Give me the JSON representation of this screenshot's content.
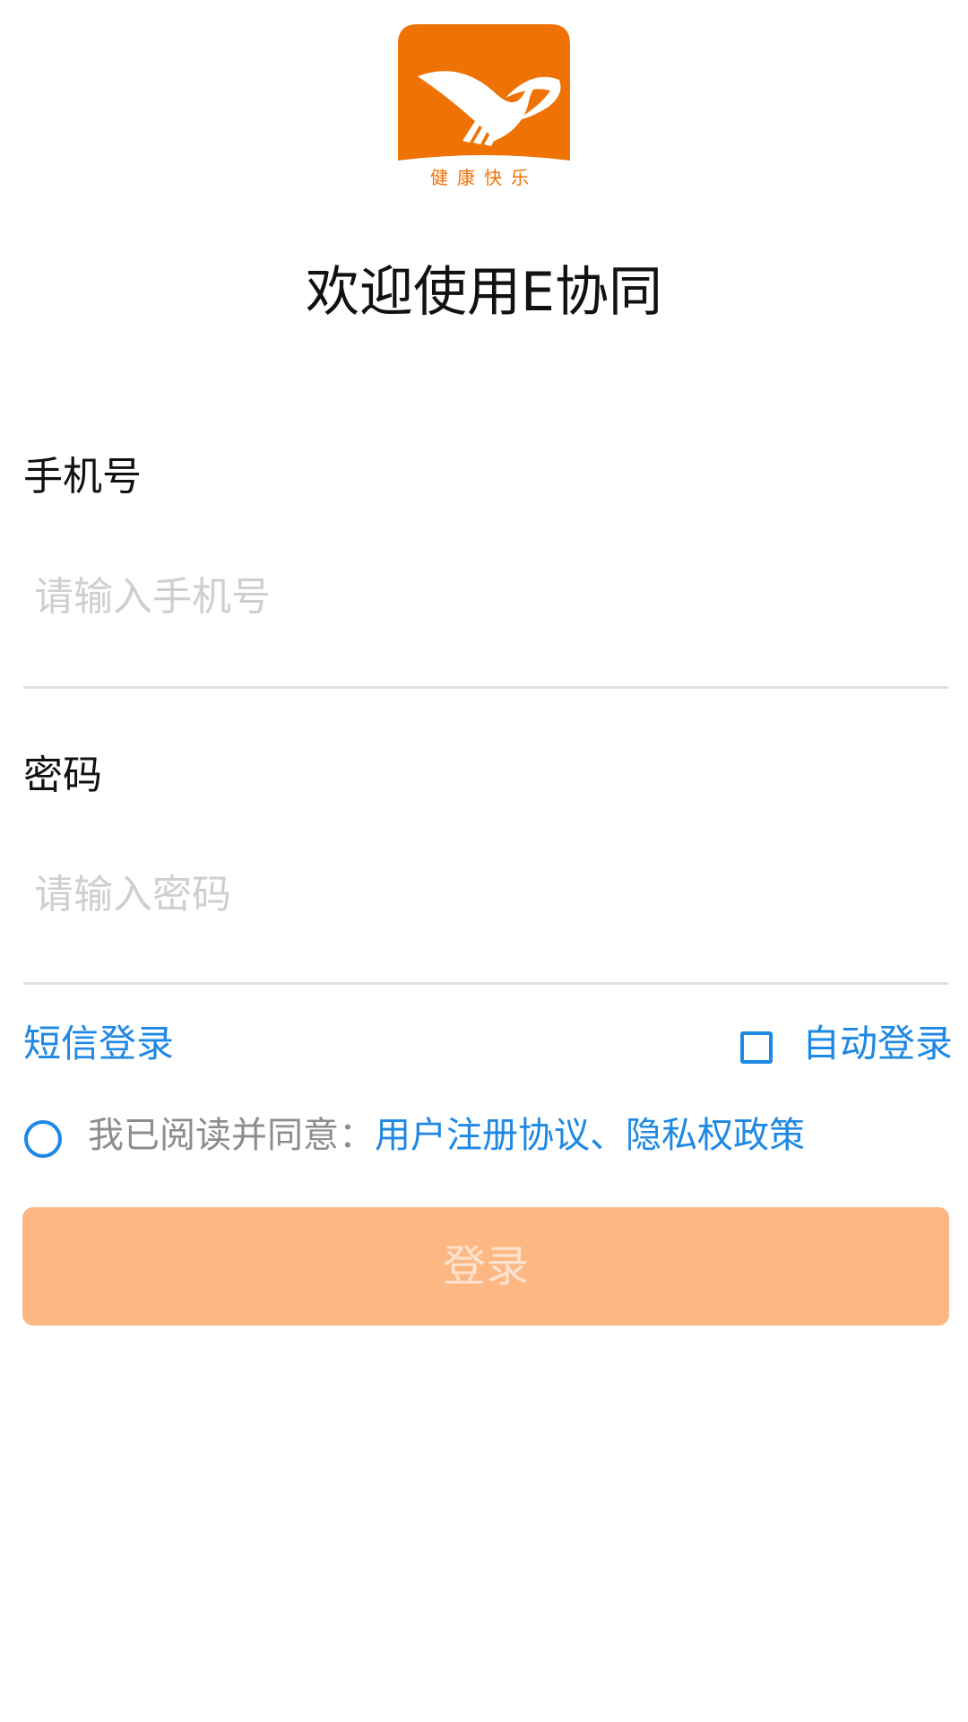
{
  "logo": {
    "icon": "bird-wing-logo",
    "caption": "健康快乐",
    "background_color": "#ef7204",
    "caption_color": "#ef7204"
  },
  "page_title": "欢迎使用E协同",
  "phone": {
    "label": "手机号",
    "placeholder": "请输入手机号",
    "value": ""
  },
  "password": {
    "label": "密码",
    "placeholder": "请输入密码",
    "value": ""
  },
  "options": {
    "sms_login": "短信登录",
    "auto_login": "自动登录",
    "auto_login_checked": false
  },
  "agreement": {
    "checked": false,
    "prefix": "我已阅读并同意：",
    "terms": "用户注册协议",
    "separator": "、",
    "privacy": "隐私权政策"
  },
  "login_button": {
    "label": "登录",
    "enabled": false,
    "color": "#fdb782"
  },
  "colors": {
    "accent_blue": "#1e88e5",
    "brand_orange": "#ef7204"
  }
}
